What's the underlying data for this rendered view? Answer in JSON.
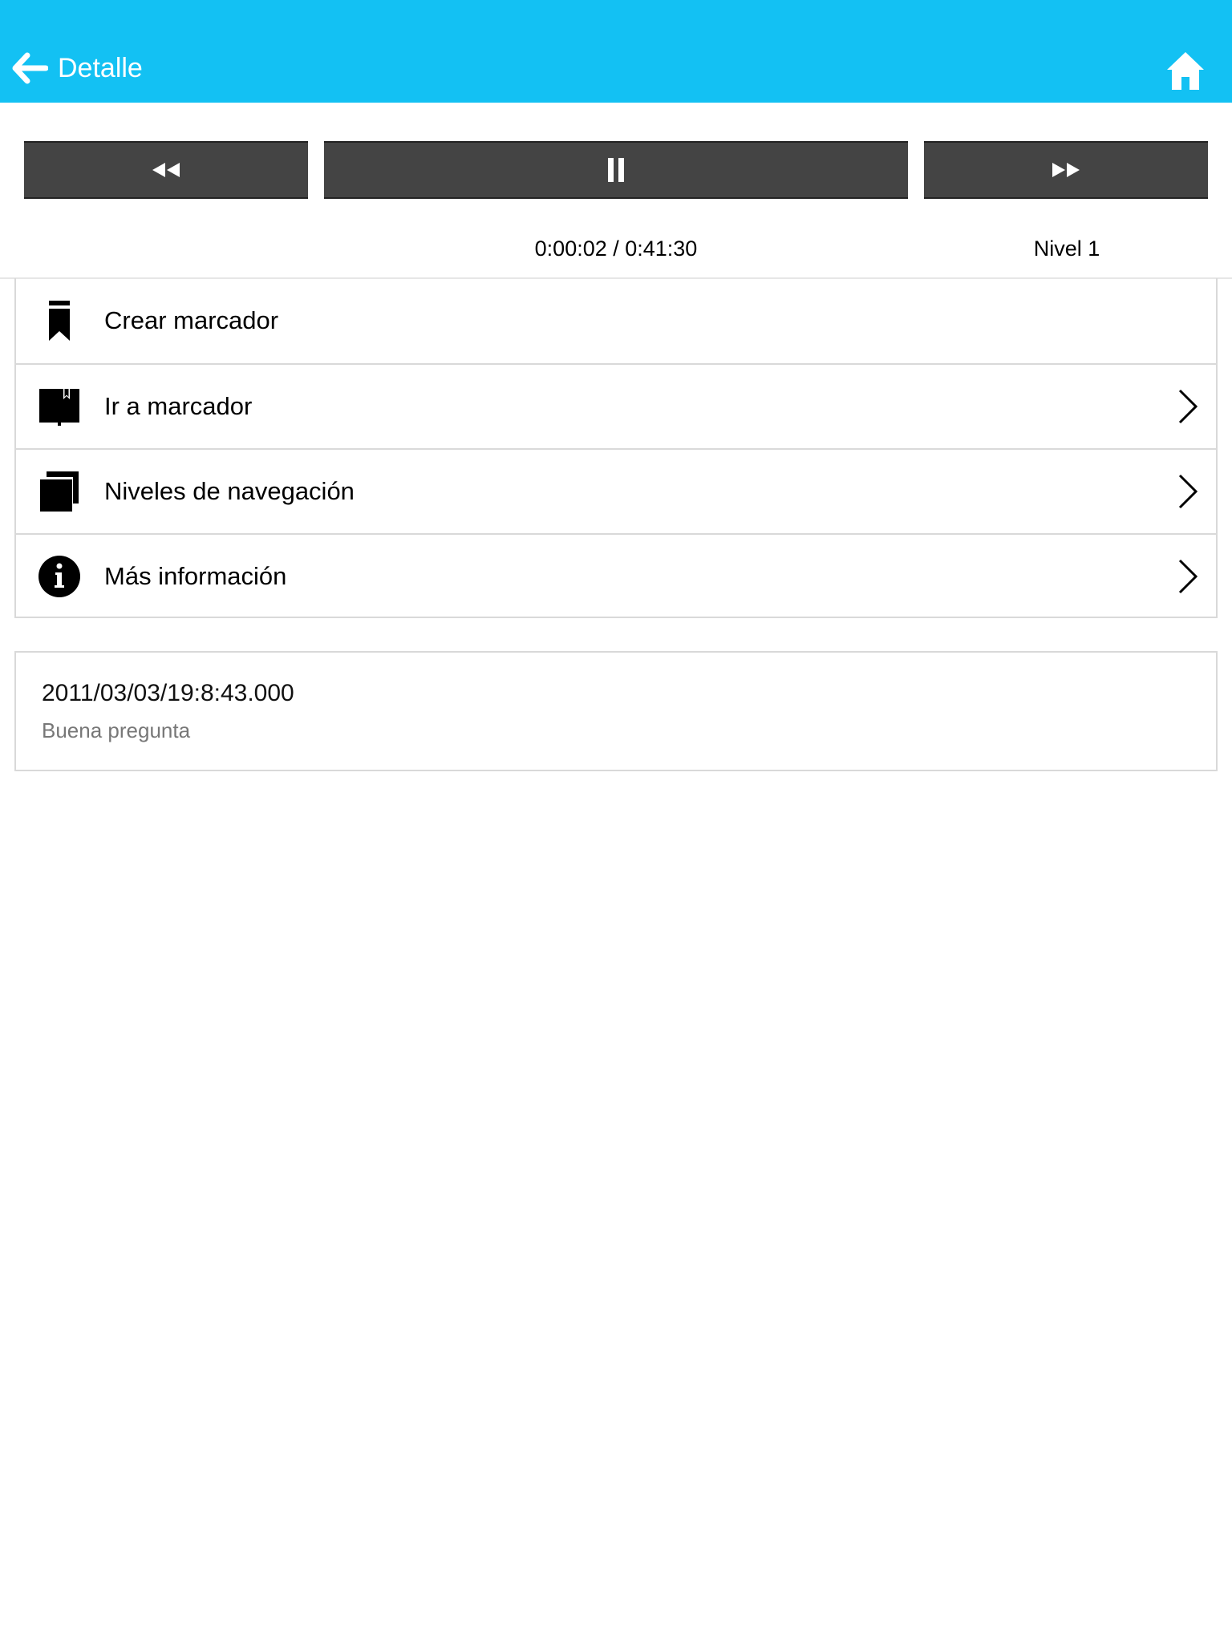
{
  "header": {
    "back_label": "Detalle",
    "background": "#13c1f3"
  },
  "player": {
    "rewind_icon": "rewind-icon",
    "pause_icon": "pause-icon",
    "fast_forward_icon": "fast-forward-icon",
    "time": "0:00:02 / 0:41:30",
    "level": "Nivel 1"
  },
  "menu": {
    "items": [
      {
        "label": "Crear marcador",
        "icon": "bookmark-icon",
        "has_chevron": false
      },
      {
        "label": "Ir a marcador",
        "icon": "book-bookmark-icon",
        "has_chevron": true
      },
      {
        "label": "Niveles de navegación",
        "icon": "layers-icon",
        "has_chevron": true
      },
      {
        "label": "Más información",
        "icon": "info-icon",
        "has_chevron": true
      }
    ]
  },
  "note": {
    "date": "2011/03/03/19:8:43.000",
    "text": "Buena pregunta"
  }
}
